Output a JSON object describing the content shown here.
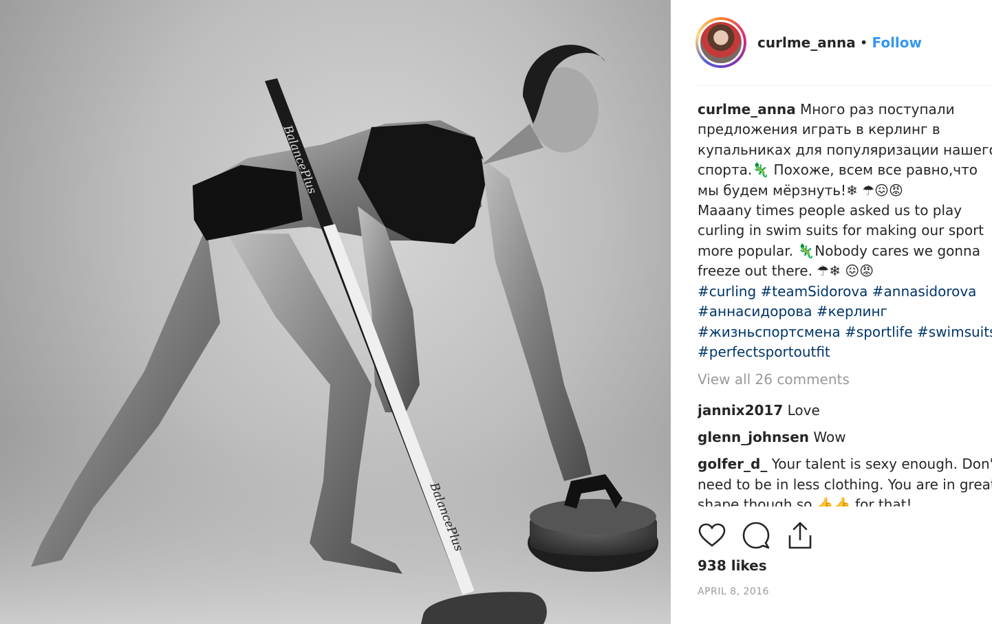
{
  "header": {
    "username": "curlme_anna",
    "separator": "•",
    "follow_label": "Follow"
  },
  "caption": {
    "username": "curlme_anna",
    "text_ru": " Много раз поступали предложения играть в керлинг в купальниках для популяризации нашего спорта.🦎 Похоже, всем все равно,что мы будем мёрзнуть!❄ ☂😖😡\nMaaany times people asked us to play curling in swim suits for making our sport more popular. 🦎Nobody cares we gonna freeze out there. ☂❄ 😖😡",
    "hashtags": [
      "#curling",
      "#teamSidorova",
      "#annasidorova",
      "#аннасидорова",
      "#керлинг",
      "#жизньспортсмена",
      "#sportlife",
      "#swimsuits",
      "#perfectsportoutfit"
    ]
  },
  "view_all_comments": "View all 26 comments",
  "comments": [
    {
      "user": "jannix2017",
      "text": "Love"
    },
    {
      "user": "glenn_johnsen",
      "text": "Wow"
    },
    {
      "user": "golfer_d_",
      "text": "Your talent is sexy enough. Don't need to be in less clothing. You are in great shape though so 👍👍 for that!"
    }
  ],
  "likes": "938 likes",
  "date": "APRIL 8, 2016",
  "broom_brand": "BalancePlus",
  "icons": {
    "like": "heart-icon",
    "comment": "comment-bubble-icon",
    "share": "share-icon"
  },
  "colors": {
    "follow": "#3897f0",
    "hashtag": "#003569",
    "muted": "#999999"
  }
}
